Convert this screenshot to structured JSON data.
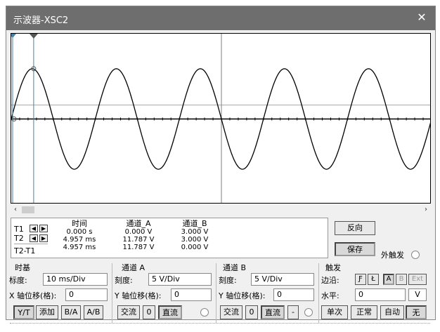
{
  "window": {
    "title": "示波器-XSC2",
    "close": "✕"
  },
  "screen": {
    "trace_color": "#000000",
    "grid_color": "#000000",
    "cursor_color": "#4a7fa0",
    "waveform": {
      "amplitude_div": 2.357,
      "cycles": 5,
      "time_div_ms": 10
    }
  },
  "scroll": {
    "left": "‹",
    "right": "›"
  },
  "readout": {
    "rows": [
      "T1",
      "T2",
      "T2-T1"
    ],
    "headers": {
      "time": "时间",
      "cha": "通道_A",
      "chb": "通道_B"
    },
    "time": [
      "0.000 s",
      "4.957 ms",
      "4.957 ms"
    ],
    "cha": [
      "0.000 V",
      "11.787 V",
      "11.787 V"
    ],
    "chb": [
      "3.000 V",
      "3.000 V",
      "0.000 V"
    ],
    "nav_left": "◀",
    "nav_right": "▶"
  },
  "actions": {
    "reverse": "反向",
    "save": "保存",
    "ext_trigger": "外触发"
  },
  "timebase": {
    "label": "时基",
    "scale_label": "标度:",
    "scale_value": "10 ms/Div",
    "xpos_label": "X 轴位移(格):",
    "xpos_value": "0",
    "buttons": [
      "Y/T",
      "添加",
      "B/A",
      "A/B"
    ]
  },
  "channel_a": {
    "label": "通道 A",
    "scale_label": "刻度:",
    "scale_value": "5  V/Div",
    "ypos_label": "Y 轴位移(格):",
    "ypos_value": "0",
    "buttons": [
      "交流",
      "0",
      "直流"
    ]
  },
  "channel_b": {
    "label": "通道 B",
    "scale_label": "刻度:",
    "scale_value": "5  V/Div",
    "ypos_label": "Y 轴位移(格):",
    "ypos_value": "0",
    "buttons": [
      "交流",
      "0",
      "直流",
      "-"
    ]
  },
  "trigger": {
    "label": "触发",
    "edge_label": "边沿:",
    "edge_buttons": [
      "Ƒ",
      "Ł",
      "A",
      "B",
      "Ext"
    ],
    "level_label": "水平:",
    "level_value": "0",
    "level_unit": "V",
    "mode_buttons": [
      "单次",
      "正常",
      "自动",
      "无"
    ]
  }
}
